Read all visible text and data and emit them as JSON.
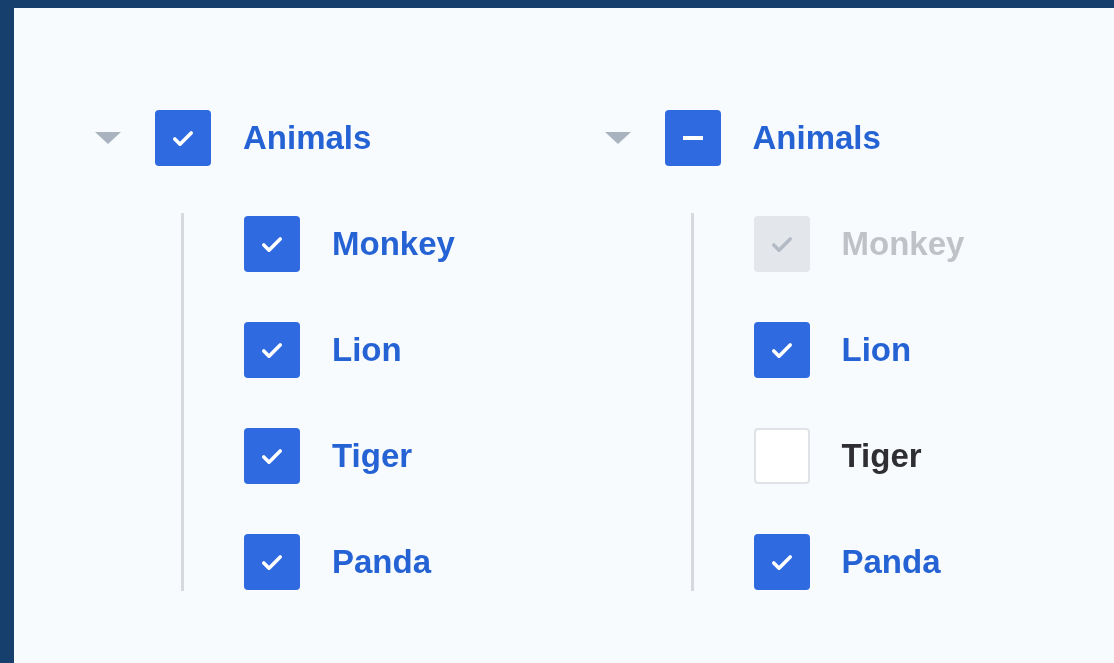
{
  "trees": [
    {
      "expanded": true,
      "label": "Animals",
      "checked": true,
      "indeterminate": false,
      "children": [
        {
          "label": "Monkey",
          "checked": true,
          "disabled": false
        },
        {
          "label": "Lion",
          "checked": true,
          "disabled": false
        },
        {
          "label": "Tiger",
          "checked": true,
          "disabled": false
        },
        {
          "label": "Panda",
          "checked": true,
          "disabled": false
        }
      ]
    },
    {
      "expanded": true,
      "label": "Animals",
      "indeterminate": true,
      "children": [
        {
          "label": "Monkey",
          "checked": true,
          "disabled": true
        },
        {
          "label": "Lion",
          "checked": true,
          "disabled": false
        },
        {
          "label": "Tiger",
          "checked": false,
          "disabled": false
        },
        {
          "label": "Panda",
          "checked": true,
          "disabled": false
        }
      ]
    }
  ]
}
